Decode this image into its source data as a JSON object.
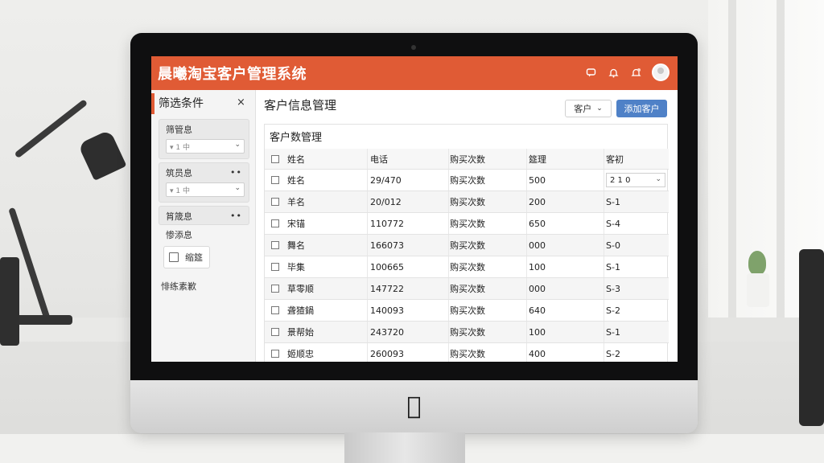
{
  "app": {
    "title": "晨曦淘宝客户管理系统"
  },
  "header_icons": [
    "message-icon",
    "bell-icon",
    "alert-bell-icon",
    "avatar"
  ],
  "sidebar": {
    "title": "筛选条件",
    "close_symbol": "×",
    "filters": [
      {
        "label": "筛管息",
        "select_value": "▾ 1 中",
        "has_dots": false
      },
      {
        "label": "筑员息",
        "select_value": "▾ 1 中",
        "has_dots": true
      },
      {
        "label": "筲筬息",
        "has_dots": true
      }
    ],
    "plain_label": "惨添息",
    "checkbox_label": "缩筵",
    "footer_label": "悱练素歉"
  },
  "main": {
    "title": "客户信息管理",
    "dropdown_label": "客户",
    "primary_button": "添加客户",
    "panel_title": "客户数管理",
    "columns": [
      "姓名",
      "电话",
      "购买次数",
      "筵理",
      "客初"
    ],
    "rows": [
      {
        "name": "姓名",
        "phone": "29/470",
        "buy": "购买次数",
        "amount": "500",
        "tag": "2 1 0",
        "tag_is_select": true
      },
      {
        "name": "羊名",
        "phone": "20/012",
        "buy": "购买次数",
        "amount": "200",
        "tag": "S-1"
      },
      {
        "name": "宋锚",
        "phone": "110772",
        "buy": "购买次数",
        "amount": "650",
        "tag": "S-4"
      },
      {
        "name": "舞名",
        "phone": "166073",
        "buy": "购买次数",
        "amount": "000",
        "tag": "S-0"
      },
      {
        "name": "毕集",
        "phone": "100665",
        "buy": "购买次数",
        "amount": "100",
        "tag": "S-1"
      },
      {
        "name": "草零顺",
        "phone": "147722",
        "buy": "购买次数",
        "amount": "000",
        "tag": "S-3"
      },
      {
        "name": "聋猹鍋",
        "phone": "140093",
        "buy": "购买次数",
        "amount": "640",
        "tag": "S-2"
      },
      {
        "name": "景帮始",
        "phone": "243720",
        "buy": "购买次数",
        "amount": "100",
        "tag": "S-1"
      },
      {
        "name": "姬顺忠",
        "phone": "260093",
        "buy": "购买次数",
        "amount": "400",
        "tag": "S-2"
      }
    ]
  },
  "colors": {
    "header": "#e05b35",
    "primary_button": "#4f81c7"
  }
}
